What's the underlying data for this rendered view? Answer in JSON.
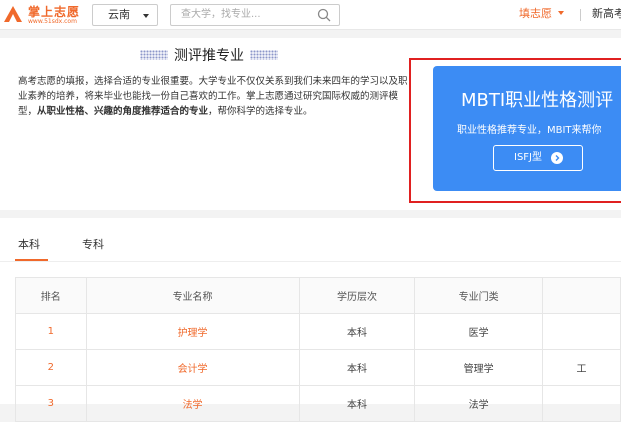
{
  "header": {
    "logo_title": "掌上志愿",
    "logo_url": "www.51sdx.com",
    "region": "云南",
    "search_placeholder": "查大学，找专业...",
    "tianzhiyuan": "填志愿",
    "new_gaokao": "新高考"
  },
  "intro": {
    "title": "测评推专业",
    "text_part1": "高考志愿的填报，选择合适的专业很重要。大学专业不仅仅关系到我们未来四年的学习以及职业素养的培养，将来毕业也能找一份自己喜欢的工作。掌上志愿通过研究国际权威的测评模型，",
    "text_bold": "从职业性格、兴趣的角度推荐适合的专业",
    "text_part2": "，帮你科学的选择专业。"
  },
  "mbti": {
    "title": "MBTI职业性格测评",
    "subtitle": "职业性格推荐专业，MBIT来帮你",
    "button": "ISFJ型"
  },
  "tabs": {
    "benke": "本科",
    "zhuanke": "专科"
  },
  "table": {
    "headers": [
      "排名",
      "专业名称",
      "学历层次",
      "专业门类",
      ""
    ],
    "rows": [
      [
        "1",
        "护理学",
        "本科",
        "医学",
        ""
      ],
      [
        "2",
        "会计学",
        "本科",
        "管理学",
        "工"
      ],
      [
        "3",
        "法学",
        "本科",
        "法学",
        ""
      ]
    ]
  },
  "colors": {
    "brand": "#f0692b",
    "mbti_bg": "#3c8cf4",
    "highlight": "#e02020"
  }
}
